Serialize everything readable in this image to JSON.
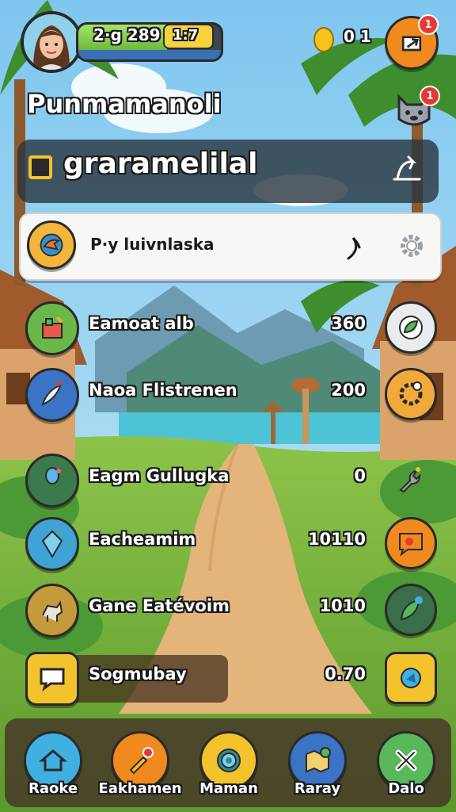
{
  "hud": {
    "xp_text": "2·g 289",
    "xp_level": "1:7",
    "xp_fill": 0.62,
    "coin_count": "0 1",
    "avatar_icon": "girl-portrait-icon",
    "mail_badge": "1",
    "pet_badge": "1"
  },
  "header": {
    "player_name": "Punmamanoli",
    "location_title": "graramelilal"
  },
  "quest_banner": {
    "text": "P·y luivnlaska",
    "icon": "bird-emblem-icon"
  },
  "rows": [
    {
      "label": "Eamoat alb",
      "value": "360",
      "left_icon": "toolkit-icon",
      "right_icon": "leaf-badge-icon"
    },
    {
      "label": "Naoa Flistrenen",
      "value": "200",
      "left_icon": "feather-brush-icon",
      "right_icon": "gear-gold-icon"
    },
    {
      "label": "Eagm Gullugka",
      "value": "0",
      "left_icon": "flower-icon",
      "right_icon": "wrench-icon"
    },
    {
      "label": "Eacheamim",
      "value": "10110",
      "left_icon": "crystal-icon",
      "right_icon": "orange-chat-icon"
    },
    {
      "label": "Gane Eatévoim",
      "value": "1010",
      "left_icon": "goat-icon",
      "right_icon": "green-leaf-icon"
    },
    {
      "label": "Sogmubay",
      "value": "0.70",
      "left_icon": "speech-bubble-icon",
      "right_icon": "blue-shield-icon"
    }
  ],
  "nav": [
    {
      "label": "Raoke",
      "icon": "home-icon"
    },
    {
      "label": "Eakhamen",
      "icon": "paint-brush-icon"
    },
    {
      "label": "Maman",
      "icon": "target-icon"
    },
    {
      "label": "Raray",
      "icon": "map-icon"
    },
    {
      "label": "Dalo",
      "icon": "tools-icon"
    }
  ]
}
